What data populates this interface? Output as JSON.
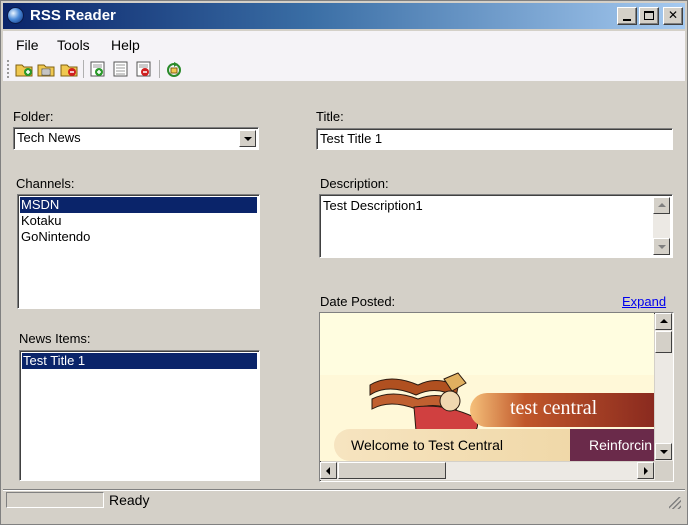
{
  "window": {
    "title": "RSS Reader"
  },
  "menu": [
    "File",
    "Tools",
    "Help"
  ],
  "toolbar": {
    "icons": [
      "add-folder-icon",
      "edit-folder-icon",
      "delete-folder-icon",
      "add-channel-icon",
      "edit-channel-icon",
      "delete-channel-icon",
      "refresh-icon"
    ]
  },
  "folder": {
    "label": "Folder:",
    "value": "Tech News"
  },
  "channels": {
    "label": "Channels:",
    "items": [
      "MSDN",
      "Kotaku",
      "GoNintendo"
    ],
    "selected_index": 0
  },
  "news": {
    "label": "News Items:",
    "items": [
      "Test Title 1"
    ],
    "selected_index": 0
  },
  "detail": {
    "title_label": "Title:",
    "title_value": "Test Title 1",
    "description_label": "Description:",
    "description_value": "Test Description1",
    "date_label": "Date Posted:",
    "expand_link": "Expand"
  },
  "webpage": {
    "logo_text": "test central",
    "welcome_text": "Welcome to Test Central",
    "banner_text": "Reinforcin",
    "colors": {
      "cream": "#fff8d8",
      "orange": "#c0572a",
      "plum": "#6a2a4a"
    }
  },
  "status": {
    "text": "Ready"
  },
  "colors": {
    "selection": "#0a246a",
    "face": "#d4d0c8",
    "link": "#0000ee"
  }
}
